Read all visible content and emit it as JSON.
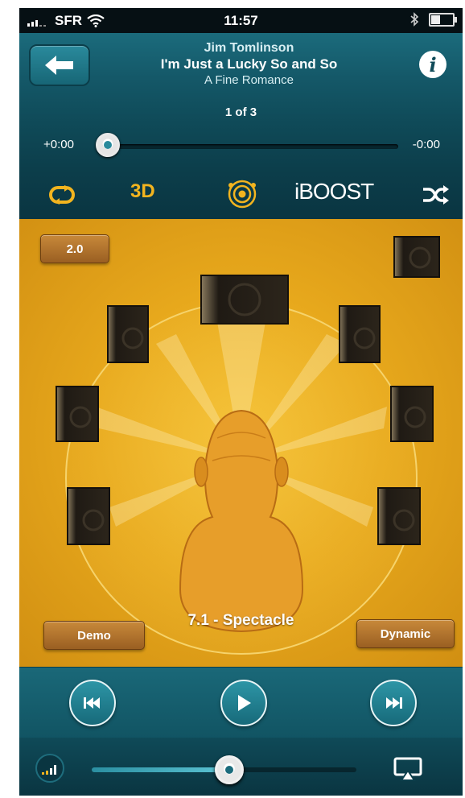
{
  "status_bar": {
    "carrier": "SFR",
    "time": "11:57"
  },
  "header": {
    "artist": "Jim Tomlinson",
    "song": "I'm Just a Lucky So and So",
    "album": "A Fine Romance",
    "track_counter": "1 of 3"
  },
  "progress": {
    "elapsed": "+0:00",
    "remaining": "-0:00",
    "position_fraction": 0.0
  },
  "toolbar": {
    "label_3d": "3D",
    "label_iboost": "iBOOST"
  },
  "stage": {
    "speaker_config_button": "2.0",
    "preset_label": "7.1 - Spectacle",
    "demo_button": "Demo",
    "dynamic_button": "Dynamic"
  },
  "volume": {
    "level_fraction": 0.52
  },
  "colors": {
    "accent_gold": "#f2b41f",
    "teal": "#1b6b7c",
    "stage_orange": "#e7a81c"
  },
  "icons": {
    "back": "back-arrow-icon",
    "info": "info-icon",
    "repeat": "repeat-icon",
    "surround": "surround-icon",
    "shuffle": "shuffle-icon",
    "previous": "previous-track-icon",
    "play": "play-icon",
    "next": "next-track-icon",
    "volume": "volume-icon",
    "airplay": "airplay-icon",
    "wifi": "wifi-icon",
    "signal": "signal-icon",
    "bluetooth": "bluetooth-icon",
    "battery": "battery-icon"
  }
}
